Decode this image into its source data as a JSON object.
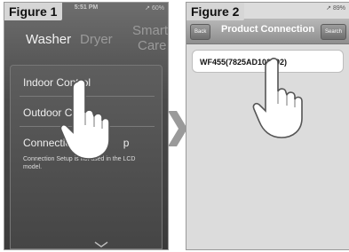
{
  "figure1": {
    "label": "Figure 1",
    "status_time": "5:51 PM",
    "status_right": "↗ 60%",
    "tabs": [
      "Washer",
      "Dryer",
      "Smart",
      "Care"
    ],
    "menu_items": [
      "Indoor Control",
      "Outdoor C",
      "Connection",
      "p"
    ],
    "note": "Connection Setup is not used in the LCD model."
  },
  "figure2": {
    "label": "Figure 2",
    "status_right": "↗ 89%",
    "back_label": "Back",
    "title": "Product Connection",
    "search_label": "Search",
    "device": "WF455(7825AD102392)"
  }
}
